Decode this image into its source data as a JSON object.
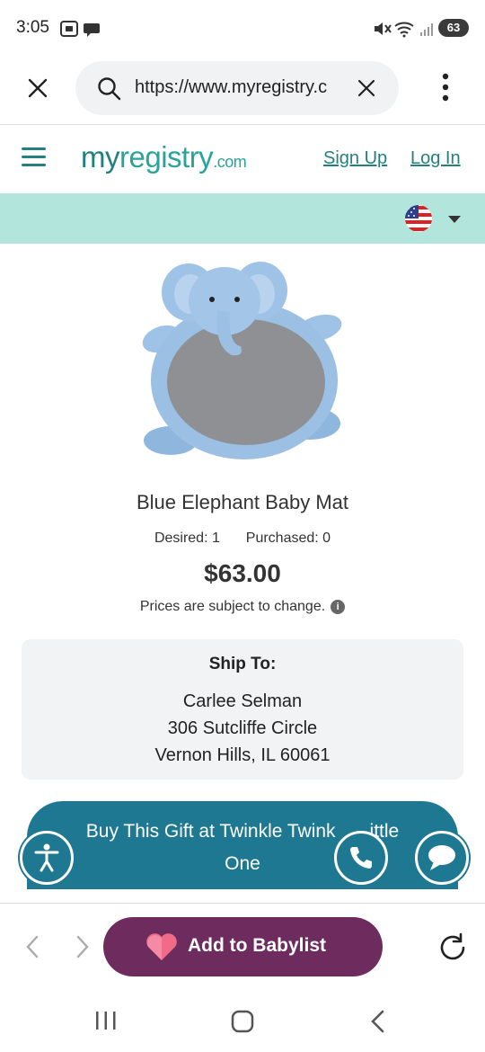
{
  "status_bar": {
    "time": "3:05",
    "battery": "63",
    "icons": [
      "screenshot-icon",
      "message-icon",
      "mute-icon",
      "wifi-icon",
      "signal-icon",
      "battery-icon"
    ]
  },
  "browser": {
    "url": "https://www.myregistry.c",
    "icons": [
      "close-icon",
      "search-icon",
      "clear-url-icon",
      "more-options-icon"
    ]
  },
  "site_header": {
    "logo_my": "my",
    "logo_registry": "registry",
    "logo_com": ".com",
    "sign_up": "Sign Up",
    "log_in": "Log In"
  },
  "product": {
    "title": "Blue Elephant Baby Mat",
    "desired": "Desired: 1",
    "purchased": "Purchased: 0",
    "price": "$63.00",
    "disclaimer": "Prices are subject to change.",
    "info_icon": "i"
  },
  "ship_to": {
    "title": "Ship To:",
    "name": "Carlee Selman",
    "street": "306 Sutcliffe Circle",
    "city": "Vernon Hills, IL 60061"
  },
  "buy": {
    "line1": "Buy This Gift at Twinkle Twink",
    "line1_tail": "ittle",
    "line2": "One"
  },
  "toolbar": {
    "babylist_label": "Add to Babylist"
  },
  "colors": {
    "teal_brand": "#23807f",
    "band": "#b2e6dc",
    "buy_button": "#1f7891",
    "babylist": "#6e2c5e"
  }
}
